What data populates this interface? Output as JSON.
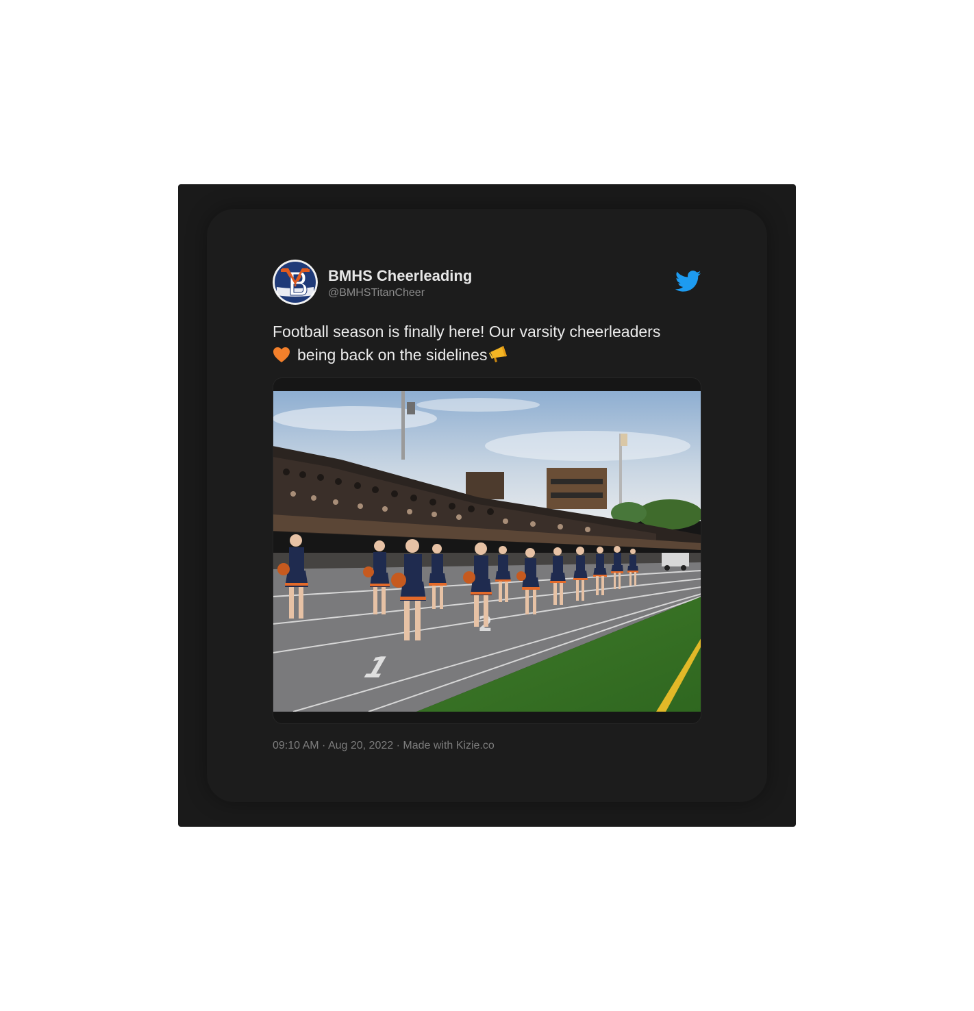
{
  "tweet": {
    "display_name": "BMHS Cheerleading",
    "handle": "@BMHSTitanCheer",
    "text_line1": "Football season is finally here!  Our varsity cheerleaders",
    "text_line2": "being back on the sidelines",
    "emoji_1": "orange-heart-icon",
    "emoji_2": "megaphone-icon",
    "time": "09:10 AM",
    "date": "Aug 20, 2022",
    "made_with": "Made with Kizie.co",
    "separator": " · "
  },
  "icons": {
    "brand": "twitter-bird-icon",
    "avatar": "bmhs-logo-avatar"
  },
  "colors": {
    "background": "#1a1a1a",
    "twitter_blue": "#1d9bf0",
    "heart": "#f4802b",
    "logo_orange": "#e05a1f",
    "logo_navy": "#1f3a78"
  },
  "media": {
    "subject": "cheerleaders-on-track-photo"
  }
}
